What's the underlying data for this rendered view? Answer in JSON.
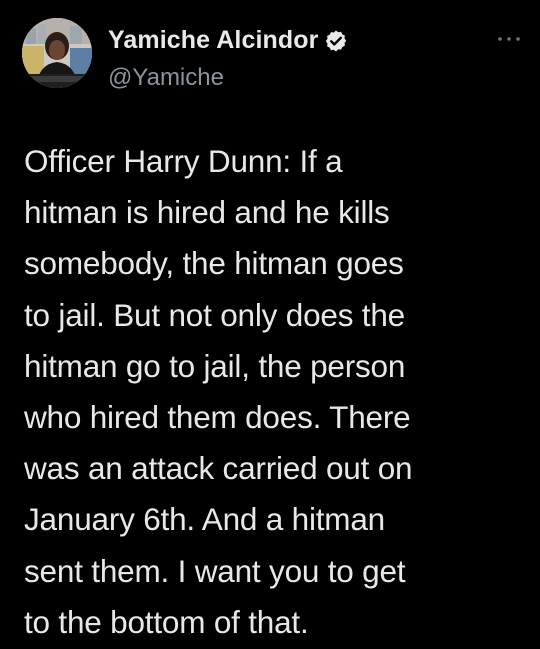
{
  "tweet": {
    "author": {
      "display_name": "Yamiche Alcindor",
      "handle": "@Yamiche",
      "verified_icon": "verified-badge-icon",
      "avatar_icon": "profile-photo"
    },
    "more_icon": "more-options-icon",
    "text": "Officer Harry Dunn: If a\nhitman is hired and he kills\nsomebody, the hitman goes\nto jail. But not only does the\nhitman go to jail, the person\nwho hired them does. There\nwas an attack carried out on\nJanuary 6th. And a hitman\nsent them. I want you to get\nto the bottom of that."
  },
  "colors": {
    "background": "#000000",
    "name": "#e7e9ea",
    "handle": "#8b949c",
    "text": "#e8e8e8",
    "badge": "#e7e9ea"
  }
}
